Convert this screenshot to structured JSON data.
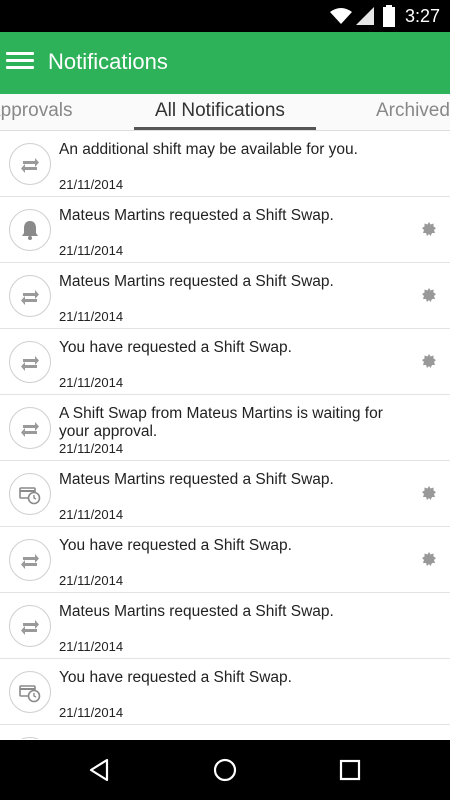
{
  "status_bar": {
    "time": "3:27"
  },
  "app_bar": {
    "title": "Notifications"
  },
  "tabs": [
    {
      "label": "Approvals"
    },
    {
      "label": "All Notifications"
    },
    {
      "label": "Archived"
    }
  ],
  "notifications": [
    {
      "text": "An additional shift may be available for you.",
      "date": "21/11/2014",
      "icon": "swap-arrows-icon",
      "unread": false
    },
    {
      "text": "Mateus Martins requested a Shift Swap.",
      "date": "21/11/2014",
      "icon": "bell-icon",
      "unread": true
    },
    {
      "text": "Mateus Martins requested a Shift Swap.",
      "date": "21/11/2014",
      "icon": "swap-arrows-icon",
      "unread": true
    },
    {
      "text": "You have requested a Shift Swap.",
      "date": "21/11/2014",
      "icon": "swap-arrows-icon",
      "unread": true
    },
    {
      "text": "A Shift Swap from Mateus Martins is waiting for your approval.",
      "date": "21/11/2014",
      "icon": "swap-arrows-icon",
      "unread": false
    },
    {
      "text": "Mateus Martins requested a Shift Swap.",
      "date": "21/11/2014",
      "icon": "card-clock-icon",
      "unread": true
    },
    {
      "text": "You have requested a Shift Swap.",
      "date": "21/11/2014",
      "icon": "swap-arrows-icon",
      "unread": true
    },
    {
      "text": "Mateus Martins requested a Shift Swap.",
      "date": "21/11/2014",
      "icon": "swap-arrows-icon",
      "unread": false
    },
    {
      "text": "You have requested a Shift Swap.",
      "date": "21/11/2014",
      "icon": "card-clock-icon",
      "unread": false
    }
  ],
  "colors": {
    "accent": "#2db25a",
    "badge": "#999999"
  }
}
